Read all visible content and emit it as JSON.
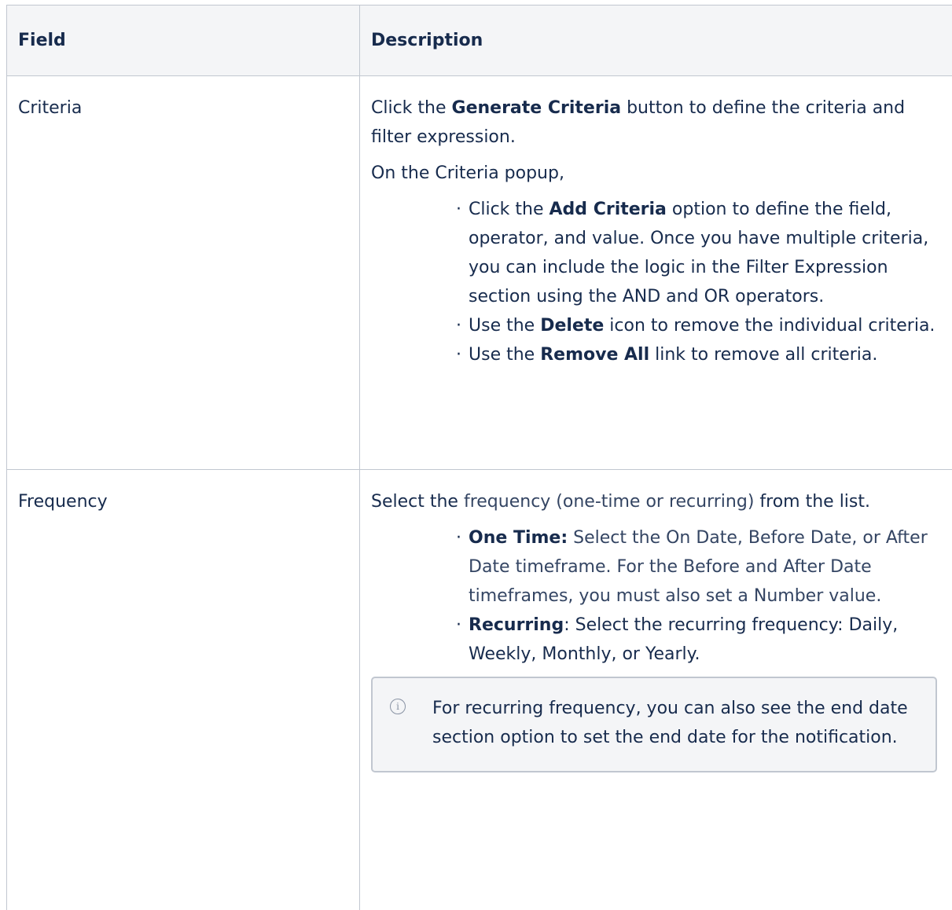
{
  "table": {
    "header_field": "Field",
    "header_description": "Description"
  },
  "criteria_row": {
    "field": "Criteria",
    "intro_pre": "Click the ",
    "intro_bold": "Generate Criteria",
    "intro_post": " button to define the criteria and filter expression.",
    "popup_text": "On the Criteria popup,",
    "bullet1_pre": "Click the ",
    "bullet1_bold": "Add Criteria",
    "bullet1_post": " option to define the field, operator, and value. Once you have multiple criteria, you can include the logic in the Filter Expression section using the AND and OR operators.",
    "bullet2_pre": "Use the ",
    "bullet2_bold": "Delete",
    "bullet2_post": " icon to remove the individual criteria.",
    "bullet3_pre": "Use the ",
    "bullet3_bold": "Remove All",
    "bullet3_post": " link to remove all criteria."
  },
  "frequency_row": {
    "field": "Frequency",
    "intro_pre": "Select the ",
    "intro_link": "frequency (one-time or recurring)",
    "intro_post": " from the list.",
    "bullet1_bold": "One Time:",
    "bullet1_post": " Select the On Date, Before Date, or After Date timeframe. For the Before and After Date timeframes, you must also set a Number value.",
    "bullet2_bold": "Recurring",
    "bullet2_post": ": Select the recurring frequency: Daily, Weekly, Monthly, or Yearly.",
    "note_text": "For recurring frequency, you can also see the end date section option to set the end date for the notification.",
    "note_icon": "info-icon"
  }
}
